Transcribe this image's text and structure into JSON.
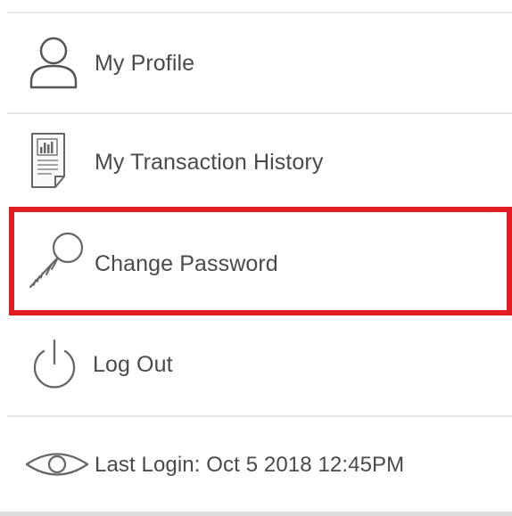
{
  "menu": {
    "items": [
      {
        "label": "My Profile",
        "icon": "user-icon"
      },
      {
        "label": "My Transaction History",
        "icon": "receipt-icon"
      },
      {
        "label": "Change Password",
        "icon": "key-icon"
      },
      {
        "label": "Log Out",
        "icon": "power-icon"
      }
    ],
    "last_login": {
      "text": "Last Login: Oct 5 2018 12:45PM",
      "icon": "eye-icon"
    },
    "highlight_color": "#e31b23"
  }
}
